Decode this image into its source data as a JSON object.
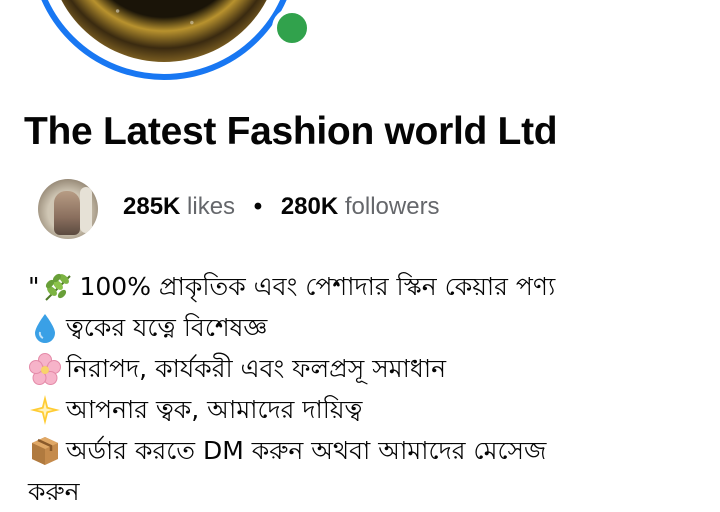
{
  "page": {
    "title": "The Latest Fashion world Ltd",
    "likes_count": "285K",
    "likes_label": "likes",
    "separator": "•",
    "followers_count": "280K",
    "followers_label": "followers"
  },
  "bio": {
    "open_quote": "\"",
    "lines": [
      {
        "icon": "leaf-icon",
        "text": "100% প্রাকৃতিক এবং পেশাদার স্কিন কেয়ার পণ্য"
      },
      {
        "icon": "droplet-icon",
        "text": "ত্বকের যত্নে বিশেষজ্ঞ"
      },
      {
        "icon": "cherry-blossom-icon",
        "text": "নিরাপদ, কার্যকরী এবং ফলপ্রসূ সমাধান"
      },
      {
        "icon": "sparkle-star-icon",
        "text": "আপনার ত্বক, আমাদের দায়িত্ব"
      },
      {
        "icon": "package-icon",
        "text": "অর্ডার করতে DM করুন অথবা আমাদের মেসেজ"
      }
    ],
    "continuation": "করুন"
  },
  "colors": {
    "ring": "#1877f2",
    "online": "#31a24c",
    "text_primary": "#050505",
    "text_secondary": "#65676b"
  }
}
